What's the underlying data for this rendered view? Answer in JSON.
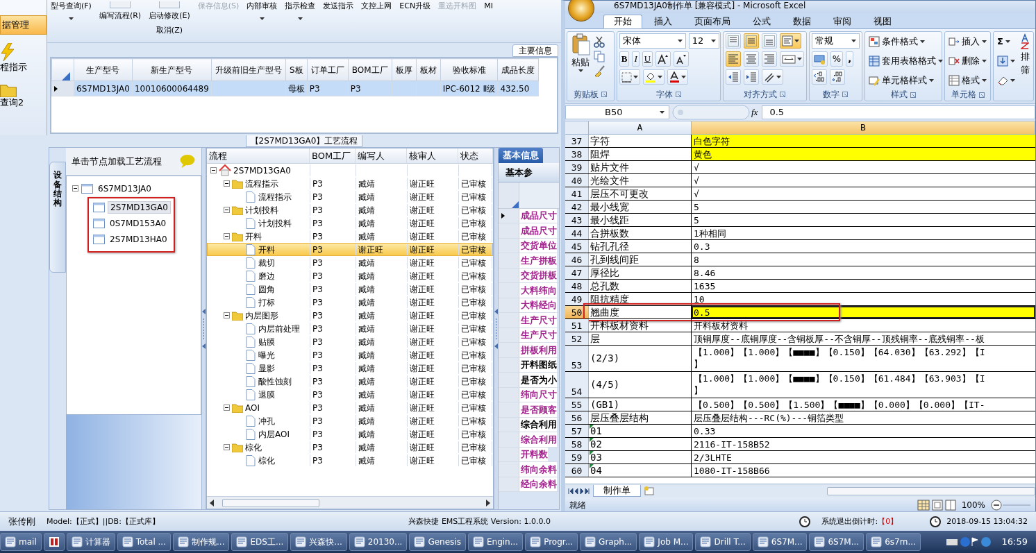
{
  "app": {
    "sidebar": {
      "header": "据管理",
      "items": [
        {
          "label": "程指示",
          "kind": "bolt"
        },
        {
          "label": "查询2",
          "kind": "folder"
        }
      ]
    },
    "toolbar": [
      {
        "buttons": [
          {
            "label": "型号查询(F)",
            "dropdown": true,
            "disabled": false,
            "stub": false
          }
        ]
      },
      {
        "buttons": [
          {
            "label": "编写流程(R)",
            "dropdown": false,
            "disabled": false,
            "stub": true
          }
        ]
      },
      {
        "buttons": [
          {
            "label": "启动修改(E)",
            "dropdown": false,
            "disabled": false,
            "stub": true
          },
          {
            "label": "取消(Z)",
            "dropdown": false,
            "disabled": false,
            "stub": false
          }
        ]
      },
      {
        "buttons": [
          {
            "label": "保存信息(S)",
            "dropdown": false,
            "disabled": true,
            "stub": false
          }
        ]
      },
      {
        "buttons": [
          {
            "label": "内部审核",
            "dropdown": true,
            "disabled": false,
            "stub": false
          }
        ]
      },
      {
        "buttons": [
          {
            "label": "指示检查",
            "dropdown": true,
            "disabled": false,
            "stub": false
          }
        ]
      },
      {
        "buttons": [
          {
            "label": "发送指示",
            "dropdown": false,
            "disabled": false,
            "stub": false
          }
        ]
      },
      {
        "buttons": [
          {
            "label": "文控上网",
            "dropdown": false,
            "disabled": false,
            "stub": false
          }
        ]
      },
      {
        "buttons": [
          {
            "label": "ECN升级",
            "dropdown": false,
            "disabled": false,
            "stub": false
          }
        ]
      },
      {
        "buttons": [
          {
            "label": "重选开料图",
            "dropdown": false,
            "disabled": true,
            "stub": false
          }
        ]
      },
      {
        "buttons": [
          {
            "label": "MI",
            "dropdown": false,
            "disabled": false,
            "stub": false
          }
        ]
      }
    ],
    "grid": {
      "tab": "主要信息",
      "columns": [
        "生产型号",
        "新生产型号",
        "升级前旧生产型号",
        "S板",
        "订单工厂",
        "BOM工厂",
        "板厚",
        "板材",
        "验收标准",
        "成品长度"
      ],
      "rows": [
        {
          "cells": [
            "6S7MD13JA0",
            "10010600064489",
            "",
            "母板",
            "P3",
            "P3",
            "",
            "",
            "IPC-6012 Ⅱ级",
            "432.50"
          ],
          "selected": true
        }
      ]
    },
    "flow": {
      "title": "【2S7MD13GA0】工艺流程",
      "side_tab": "设备结构",
      "tree_header": "单击节点加载工艺流程",
      "tree": [
        {
          "label": "6S7MD13JA0",
          "expanded": true,
          "selected": false,
          "children_boxed": true,
          "children": [
            {
              "label": "2S7MD13GA0",
              "selected": true
            },
            {
              "label": "0S7MD153A0",
              "selected": false
            },
            {
              "label": "2S7MD13HA0",
              "selected": false
            }
          ]
        }
      ],
      "columns": [
        "流程",
        "BOM工厂",
        "编写人",
        "核审人",
        "状态"
      ],
      "steps": [
        {
          "label": "2S7MD13GA0",
          "kind": "root",
          "expanded": true,
          "selected": false,
          "children": [
            {
              "label": "流程指示",
              "kind": "group",
              "bom": "P3",
              "writer": "臧靖",
              "reviewer": "谢正旺",
              "status": "已审核",
              "expanded": true,
              "selected": false,
              "children": [
                {
                  "label": "流程指示",
                  "kind": "step",
                  "bom": "P3",
                  "writer": "臧靖",
                  "reviewer": "谢正旺",
                  "status": "已审核",
                  "selected": false
                }
              ]
            },
            {
              "label": "计划投料",
              "kind": "group",
              "bom": "P3",
              "writer": "臧靖",
              "reviewer": "谢正旺",
              "status": "已审核",
              "expanded": true,
              "selected": false,
              "children": [
                {
                  "label": "计划投料",
                  "kind": "step",
                  "bom": "P3",
                  "writer": "臧靖",
                  "reviewer": "谢正旺",
                  "status": "已审核",
                  "selected": false
                }
              ]
            },
            {
              "label": "开料",
              "kind": "group",
              "bom": "P3",
              "writer": "臧靖",
              "reviewer": "谢正旺",
              "status": "已审核",
              "expanded": true,
              "selected": false,
              "children": [
                {
                  "label": "开料",
                  "kind": "step",
                  "bom": "P3",
                  "writer": "谢正旺",
                  "reviewer": "谢正旺",
                  "status": "已审核",
                  "selected": true
                },
                {
                  "label": "裁切",
                  "kind": "step",
                  "bom": "P3",
                  "writer": "臧靖",
                  "reviewer": "谢正旺",
                  "status": "已审核",
                  "selected": false
                },
                {
                  "label": "磨边",
                  "kind": "step",
                  "bom": "P3",
                  "writer": "臧靖",
                  "reviewer": "谢正旺",
                  "status": "已审核",
                  "selected": false
                },
                {
                  "label": "圆角",
                  "kind": "step",
                  "bom": "P3",
                  "writer": "臧靖",
                  "reviewer": "谢正旺",
                  "status": "已审核",
                  "selected": false
                },
                {
                  "label": "打标",
                  "kind": "step",
                  "bom": "P3",
                  "writer": "臧靖",
                  "reviewer": "谢正旺",
                  "status": "已审核",
                  "selected": false
                }
              ]
            },
            {
              "label": "内层图形",
              "kind": "group",
              "bom": "P3",
              "writer": "臧靖",
              "reviewer": "谢正旺",
              "status": "已审核",
              "expanded": true,
              "selected": false,
              "children": [
                {
                  "label": "内层前处理",
                  "kind": "step",
                  "bom": "P3",
                  "writer": "臧靖",
                  "reviewer": "谢正旺",
                  "status": "已审核",
                  "selected": false
                },
                {
                  "label": "贴膜",
                  "kind": "step",
                  "bom": "P3",
                  "writer": "臧靖",
                  "reviewer": "谢正旺",
                  "status": "已审核",
                  "selected": false
                },
                {
                  "label": "曝光",
                  "kind": "step",
                  "bom": "P3",
                  "writer": "臧靖",
                  "reviewer": "谢正旺",
                  "status": "已审核",
                  "selected": false
                },
                {
                  "label": "显影",
                  "kind": "step",
                  "bom": "P3",
                  "writer": "臧靖",
                  "reviewer": "谢正旺",
                  "status": "已审核",
                  "selected": false
                },
                {
                  "label": "酸性蚀刻",
                  "kind": "step",
                  "bom": "P3",
                  "writer": "臧靖",
                  "reviewer": "谢正旺",
                  "status": "已审核",
                  "selected": false
                },
                {
                  "label": "退膜",
                  "kind": "step",
                  "bom": "P3",
                  "writer": "臧靖",
                  "reviewer": "谢正旺",
                  "status": "已审核",
                  "selected": false
                }
              ]
            },
            {
              "label": "AOI",
              "kind": "group",
              "bom": "P3",
              "writer": "臧靖",
              "reviewer": "谢正旺",
              "status": "已审核",
              "expanded": true,
              "selected": false,
              "children": [
                {
                  "label": "冲孔",
                  "kind": "step",
                  "bom": "P3",
                  "writer": "臧靖",
                  "reviewer": "谢正旺",
                  "status": "已审核",
                  "selected": false
                },
                {
                  "label": "内层AOI",
                  "kind": "step",
                  "bom": "P3",
                  "writer": "臧靖",
                  "reviewer": "谢正旺",
                  "status": "已审核",
                  "selected": false
                }
              ]
            },
            {
              "label": "棕化",
              "kind": "group",
              "bom": "P3",
              "writer": "臧靖",
              "reviewer": "谢正旺",
              "status": "已审核",
              "expanded": true,
              "selected": false,
              "children": [
                {
                  "label": "棕化",
                  "kind": "step",
                  "bom": "P3",
                  "writer": "臧靖",
                  "reviewer": "谢正旺",
                  "status": "已审核",
                  "selected": false
                }
              ]
            }
          ]
        }
      ]
    },
    "info": {
      "tabs": [
        {
          "label": "基本信息",
          "selected": true
        }
      ],
      "subtab": "基本参",
      "rows": [
        {
          "label": "成品尺寸",
          "color": "#a3238e",
          "selected": true
        },
        {
          "label": "成品尺寸",
          "color": "#a3238e",
          "selected": false
        },
        {
          "label": "交货单位",
          "color": "#a3238e",
          "selected": false
        },
        {
          "label": "生产拼板",
          "color": "#a3238e",
          "selected": false
        },
        {
          "label": "交货拼板",
          "color": "#a3238e",
          "selected": false
        },
        {
          "label": "大料纬向",
          "color": "#a3238e",
          "selected": false
        },
        {
          "label": "大料经向",
          "color": "#a3238e",
          "selected": false
        },
        {
          "label": "生产尺寸",
          "color": "#a3238e",
          "selected": false
        },
        {
          "label": "生产尺寸",
          "color": "#a3238e",
          "selected": false
        },
        {
          "label": "拼板利用",
          "color": "#a3238e",
          "selected": false
        },
        {
          "label": "开料图纸",
          "color": "#000000",
          "selected": false
        },
        {
          "label": "是否为小",
          "color": "#000000",
          "selected": false
        },
        {
          "label": "纬向尺寸",
          "color": "#a3238e",
          "selected": false
        },
        {
          "label": "是否顾客",
          "color": "#a3238e",
          "selected": false
        },
        {
          "label": "综合利用",
          "color": "#000000",
          "selected": false
        },
        {
          "label": "综合利用",
          "color": "#a3238e",
          "selected": false
        },
        {
          "label": "开料数",
          "color": "#a3238e",
          "selected": false
        },
        {
          "label": "纬向余料",
          "color": "#a3238e",
          "selected": false
        },
        {
          "label": "经向余料",
          "color": "#a3238e",
          "selected": false
        }
      ]
    },
    "status": {
      "user": "张传刚",
      "model": "Model:【正式】||DB:【正式库】",
      "system": "兴森快捷 EMS工程系统 Version: 1.0.0.0",
      "countdown_label": "系统退出倒计时:",
      "countdown": "【0】",
      "datetime": "2018-09-15 13:04:32"
    }
  },
  "excel": {
    "title": "6S7MD13JA0制作单 [兼容模式] - Microsoft Excel",
    "tabs": [
      {
        "label": "开始",
        "selected": true
      },
      {
        "label": "插入",
        "selected": false
      },
      {
        "label": "页面布局",
        "selected": false
      },
      {
        "label": "公式",
        "selected": false
      },
      {
        "label": "数据",
        "selected": false
      },
      {
        "label": "审阅",
        "selected": false
      },
      {
        "label": "视图",
        "selected": false
      }
    ],
    "ribbon": {
      "clipboard": {
        "label": "剪贴板",
        "paste": "粘贴"
      },
      "font": {
        "label": "字体",
        "name": "宋体",
        "size": "12",
        "bold": "B",
        "italic": "I",
        "underline": "U"
      },
      "alignment": {
        "label": "对齐方式",
        "buttons": [
          {
            "kind": "top",
            "selected": false
          },
          {
            "kind": "middle",
            "selected": true
          },
          {
            "kind": "bottom",
            "selected": false
          },
          {
            "kind": "wrap",
            "selected": true
          },
          {
            "kind": "left",
            "selected": true
          },
          {
            "kind": "center",
            "selected": false
          },
          {
            "kind": "right",
            "selected": false
          },
          {
            "kind": "merge",
            "selected": false
          },
          {
            "kind": "outdent",
            "selected": false
          },
          {
            "kind": "indent",
            "selected": false
          },
          {
            "kind": "orientation",
            "selected": false
          }
        ]
      },
      "number": {
        "label": "数字",
        "format": "常规",
        "percent": "%",
        "comma": ","
      },
      "styles": {
        "label": "样式",
        "items": [
          "条件格式",
          "套用表格格式",
          "单元格样式"
        ]
      },
      "cells": {
        "label": "单元格",
        "items": [
          "插入",
          "删除",
          "格式"
        ]
      },
      "editing": {
        "sum": "Σ",
        "sort": "排",
        "filter": "筛"
      }
    },
    "name_box": "B50",
    "function_label": "fx",
    "formula": "0.5",
    "columns": [
      "A",
      "B"
    ],
    "rows": [
      {
        "num": "37",
        "a": "字符",
        "b": "白色字符",
        "color": "#ffff00",
        "selected": false,
        "boxed": false,
        "flag": false
      },
      {
        "num": "38",
        "a": "阻焊",
        "b": "黄色",
        "color": "#ffff00",
        "selected": false,
        "boxed": false,
        "flag": false
      },
      {
        "num": "39",
        "a": "贴片文件",
        "b": "√",
        "selected": false,
        "boxed": false,
        "flag": false
      },
      {
        "num": "40",
        "a": "光绘文件",
        "b": "√",
        "selected": false,
        "boxed": false,
        "flag": false
      },
      {
        "num": "41",
        "a": "层压不可更改",
        "b": "√",
        "selected": false,
        "boxed": false,
        "flag": false
      },
      {
        "num": "42",
        "a": "最小线宽",
        "b": "5",
        "selected": false,
        "boxed": false,
        "flag": false
      },
      {
        "num": "43",
        "a": "最小线距",
        "b": "5",
        "selected": false,
        "boxed": false,
        "flag": false
      },
      {
        "num": "44",
        "a": "合拼板数",
        "b": "1种相同",
        "selected": false,
        "boxed": false,
        "flag": false
      },
      {
        "num": "45",
        "a": "钻孔孔径",
        "b": "0.3",
        "selected": false,
        "boxed": false,
        "flag": false
      },
      {
        "num": "46",
        "a": "孔到线间距",
        "b": "8",
        "selected": false,
        "boxed": false,
        "flag": false
      },
      {
        "num": "47",
        "a": "厚径比",
        "b": "8.46",
        "selected": false,
        "boxed": false,
        "flag": false
      },
      {
        "num": "48",
        "a": "总孔数",
        "b": "1635",
        "selected": false,
        "boxed": false,
        "flag": false
      },
      {
        "num": "49",
        "a": "阻抗精度",
        "b": "10",
        "selected": false,
        "boxed": false,
        "flag": false
      },
      {
        "num": "50",
        "a": "翘曲度",
        "b": "0.5",
        "color": "#ffff00",
        "selected": true,
        "boxed": true,
        "flag": false
      },
      {
        "num": "51",
        "a": "开料板材资料",
        "b": "开料板材资料",
        "selected": false,
        "boxed": false,
        "flag": false
      },
      {
        "num": "52",
        "a": "层",
        "b": "顶铜厚度--底铜厚度--含铜板厚--不含铜厚--顶残铜率--底残铜率--板",
        "selected": false,
        "boxed": false,
        "flag": false
      },
      {
        "num": "53",
        "a": "(2/3)",
        "b": "【1.000】【1.000】【■■■■】【0.150】【64.030】【63.292】【I",
        "b_cont": "】",
        "selected": false,
        "boxed": false,
        "flag": false
      },
      {
        "num": "54",
        "a": "(4/5)",
        "b": "【1.000】【1.000】【■■■■】【0.150】【61.484】【63.903】【I",
        "b_cont": "】",
        "selected": false,
        "boxed": false,
        "flag": false
      },
      {
        "num": "55",
        "a": "(GB1)",
        "b": "【0.500】【0.500】【1.500】【■■■■】【0.000】【0.000】【IT-",
        "selected": false,
        "boxed": false,
        "flag": false
      },
      {
        "num": "56",
        "a": "层压叠层结构",
        "b": "层压叠层结构---RC(%)---铜箔类型",
        "selected": false,
        "boxed": false,
        "flag": false
      },
      {
        "num": "57",
        "a": "01",
        "b": "0.33",
        "selected": false,
        "boxed": false,
        "flag": true
      },
      {
        "num": "58",
        "a": "02",
        "b": "2116-IT-158B52",
        "selected": false,
        "boxed": false,
        "flag": true
      },
      {
        "num": "59",
        "a": "03",
        "b": "2/3LHTE",
        "selected": false,
        "boxed": false,
        "flag": true
      },
      {
        "num": "60",
        "a": "04",
        "b": "1080-IT-158B66",
        "selected": false,
        "boxed": false,
        "flag": true
      }
    ],
    "sheet_tab": "制作单",
    "status": "就绪",
    "zoom": "100%"
  },
  "taskbar": {
    "items": [
      {
        "kind": "app",
        "label": "mail"
      },
      {
        "kind": "icon"
      },
      {
        "kind": "app",
        "label": "计算器"
      },
      {
        "kind": "app",
        "label": "Total ..."
      },
      {
        "kind": "app",
        "label": "制作规..."
      },
      {
        "kind": "app",
        "label": "EDS工..."
      },
      {
        "kind": "app",
        "label": "兴森快..."
      },
      {
        "kind": "app",
        "label": "20130..."
      },
      {
        "kind": "app",
        "label": "Genesis"
      },
      {
        "kind": "app",
        "label": "Engin..."
      },
      {
        "kind": "app",
        "label": "Progr..."
      },
      {
        "kind": "app",
        "label": "Graph..."
      },
      {
        "kind": "app",
        "label": "Job M..."
      },
      {
        "kind": "app",
        "label": "Drill T..."
      },
      {
        "kind": "app",
        "label": "6S7M..."
      },
      {
        "kind": "app",
        "label": "6S7M..."
      },
      {
        "kind": "app",
        "label": "6s7m..."
      }
    ],
    "clock": "16:59"
  }
}
